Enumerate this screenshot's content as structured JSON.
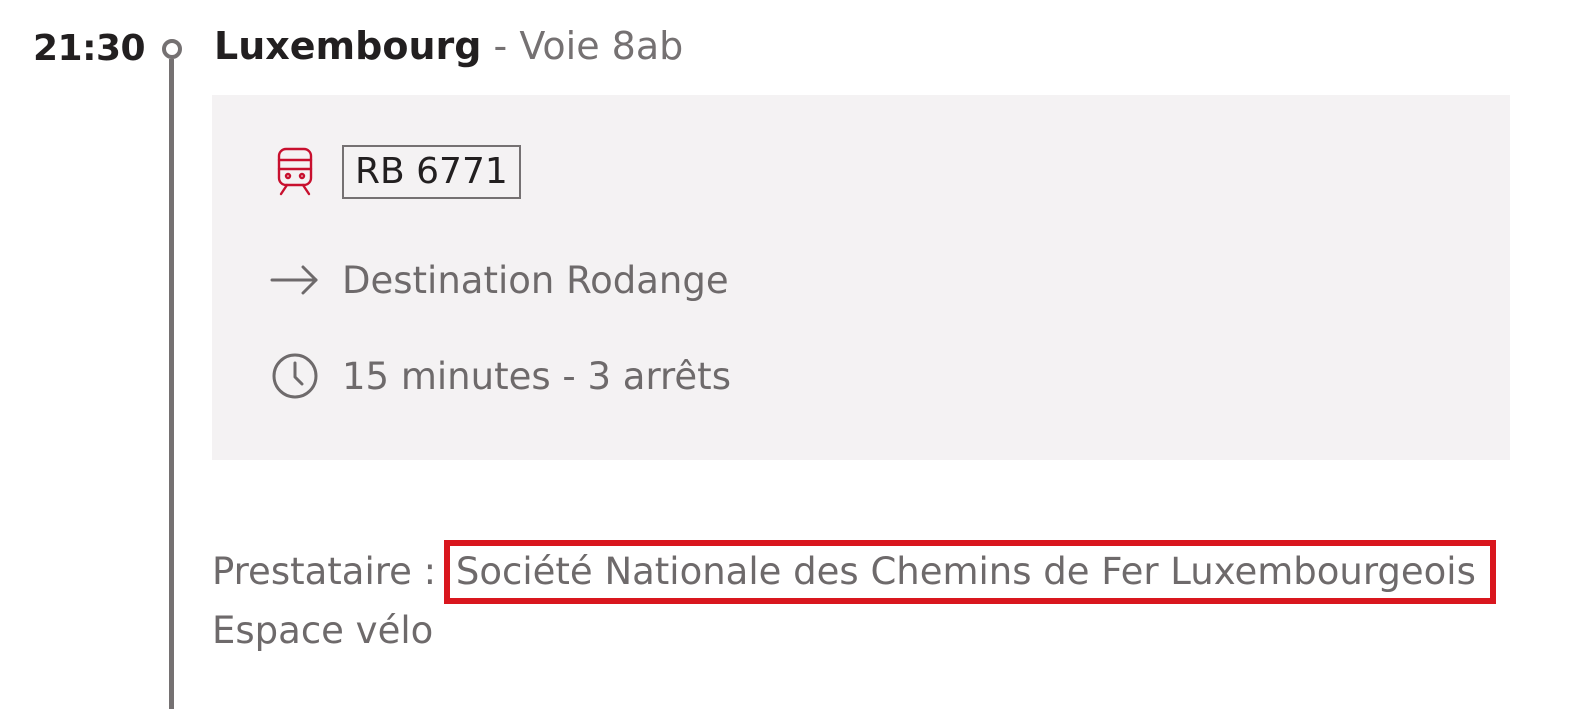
{
  "stop": {
    "time": "21:30",
    "station": "Luxembourg",
    "platform": "- Voie 8ab"
  },
  "train": {
    "icon": "train-icon",
    "number": "RB 6771"
  },
  "destination": {
    "icon": "arrow-right-icon",
    "text": "Destination Rodange"
  },
  "duration": {
    "icon": "clock-icon",
    "text": "15 minutes - 3 arrêts"
  },
  "provider": {
    "label": "Prestataire :",
    "name": "Société Nationale des Chemins de Fer Luxembourgeois"
  },
  "amenities": {
    "bike": "Espace vélo"
  },
  "colors": {
    "accent": "#c8102e",
    "highlight": "#d9161e",
    "card_bg": "#f4f2f3",
    "timeline": "#757172"
  }
}
